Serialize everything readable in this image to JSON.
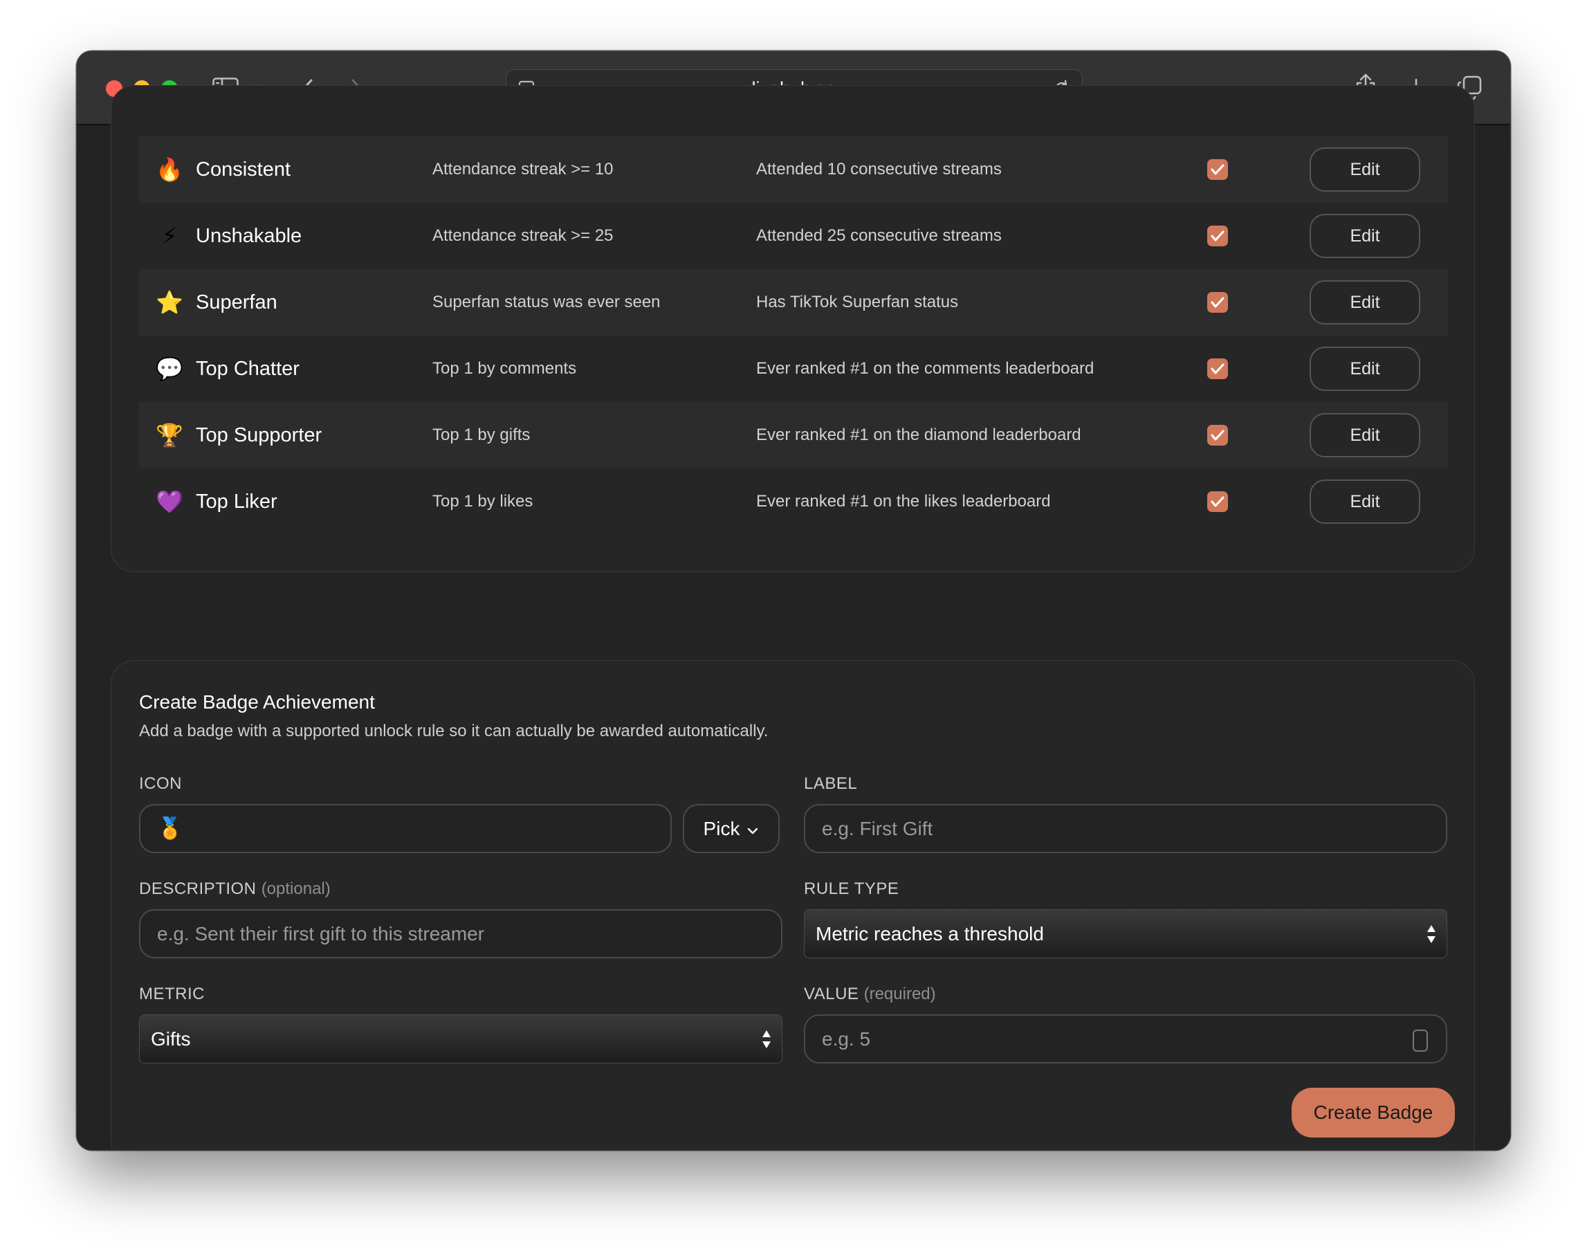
{
  "browser": {
    "url": "livehub.gg"
  },
  "badges": [
    {
      "icon": "🔥",
      "name": "Consistent",
      "rule": "Attendance streak >= 10",
      "description": "Attended 10 consecutive streams",
      "enabled": true,
      "edit_label": "Edit"
    },
    {
      "icon": "⚡",
      "name": "Unshakable",
      "rule": "Attendance streak >= 25",
      "description": "Attended 25 consecutive streams",
      "enabled": true,
      "edit_label": "Edit"
    },
    {
      "icon": "⭐",
      "name": "Superfan",
      "rule": "Superfan status was ever seen",
      "description": "Has TikTok Superfan status",
      "enabled": true,
      "edit_label": "Edit"
    },
    {
      "icon": "💬",
      "name": "Top Chatter",
      "rule": "Top 1 by comments",
      "description": "Ever ranked #1 on the comments leaderboard",
      "enabled": true,
      "edit_label": "Edit"
    },
    {
      "icon": "🏆",
      "name": "Top Supporter",
      "rule": "Top 1 by gifts",
      "description": "Ever ranked #1 on the diamond leaderboard",
      "enabled": true,
      "edit_label": "Edit"
    },
    {
      "icon": "💜",
      "name": "Top Liker",
      "rule": "Top 1 by likes",
      "description": "Ever ranked #1 on the likes leaderboard",
      "enabled": true,
      "edit_label": "Edit"
    }
  ],
  "create_form": {
    "title": "Create Badge Achievement",
    "subtitle": "Add a badge with a supported unlock rule so it can actually be awarded automatically.",
    "icon_label": "ICON",
    "icon_value": "🏅",
    "pick_label": "Pick",
    "label_label": "LABEL",
    "label_placeholder": "e.g. First Gift",
    "description_label": "DESCRIPTION",
    "description_optional": "(optional)",
    "description_placeholder": "e.g. Sent their first gift to this streamer",
    "rule_type_label": "RULE TYPE",
    "rule_type_value": "Metric reaches a threshold",
    "metric_label": "METRIC",
    "metric_value": "Gifts",
    "value_label": "VALUE",
    "value_required": "(required)",
    "value_placeholder": "e.g. 5",
    "submit_label": "Create Badge"
  },
  "colors": {
    "accent": "#d2785a",
    "background": "#232323",
    "row_alt": "#2c2c2c"
  }
}
